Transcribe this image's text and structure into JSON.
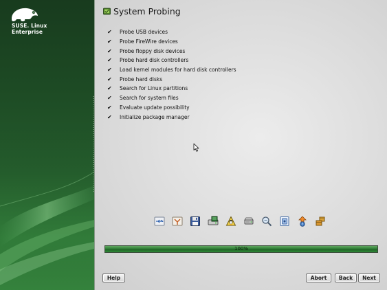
{
  "brand": {
    "line1": "SUSE. Linux",
    "line2": "Enterprise",
    "logo_icon": "suse-chameleon-icon"
  },
  "page": {
    "title": "System Probing",
    "title_icon": "probing-icon"
  },
  "steps": [
    {
      "label": "Probe USB devices",
      "done": true
    },
    {
      "label": "Probe FireWire devices",
      "done": true
    },
    {
      "label": "Probe floppy disk devices",
      "done": true
    },
    {
      "label": "Probe hard disk controllers",
      "done": true
    },
    {
      "label": "Load kernel modules for hard disk controllers",
      "done": true
    },
    {
      "label": "Probe hard disks",
      "done": true
    },
    {
      "label": "Search for Linux partitions",
      "done": true
    },
    {
      "label": "Search for system files",
      "done": true
    },
    {
      "label": "Evaluate update possibility",
      "done": true
    },
    {
      "label": "Initialize package manager",
      "done": true
    }
  ],
  "check_glyph": "✔",
  "icons": [
    "usb-icon",
    "firewire-icon",
    "floppy-icon",
    "disk-controller-icon",
    "kernel-module-icon",
    "hard-disk-icon",
    "search-partitions-icon",
    "system-files-icon",
    "update-icon",
    "package-manager-icon"
  ],
  "progress": {
    "value": 1.0,
    "text": "100%"
  },
  "buttons": {
    "help": "Help",
    "abort": "Abort",
    "back": "Back",
    "next": "Next"
  },
  "colors": {
    "brand_green": "#2f7a38",
    "progress_green": "#2f7d35"
  }
}
